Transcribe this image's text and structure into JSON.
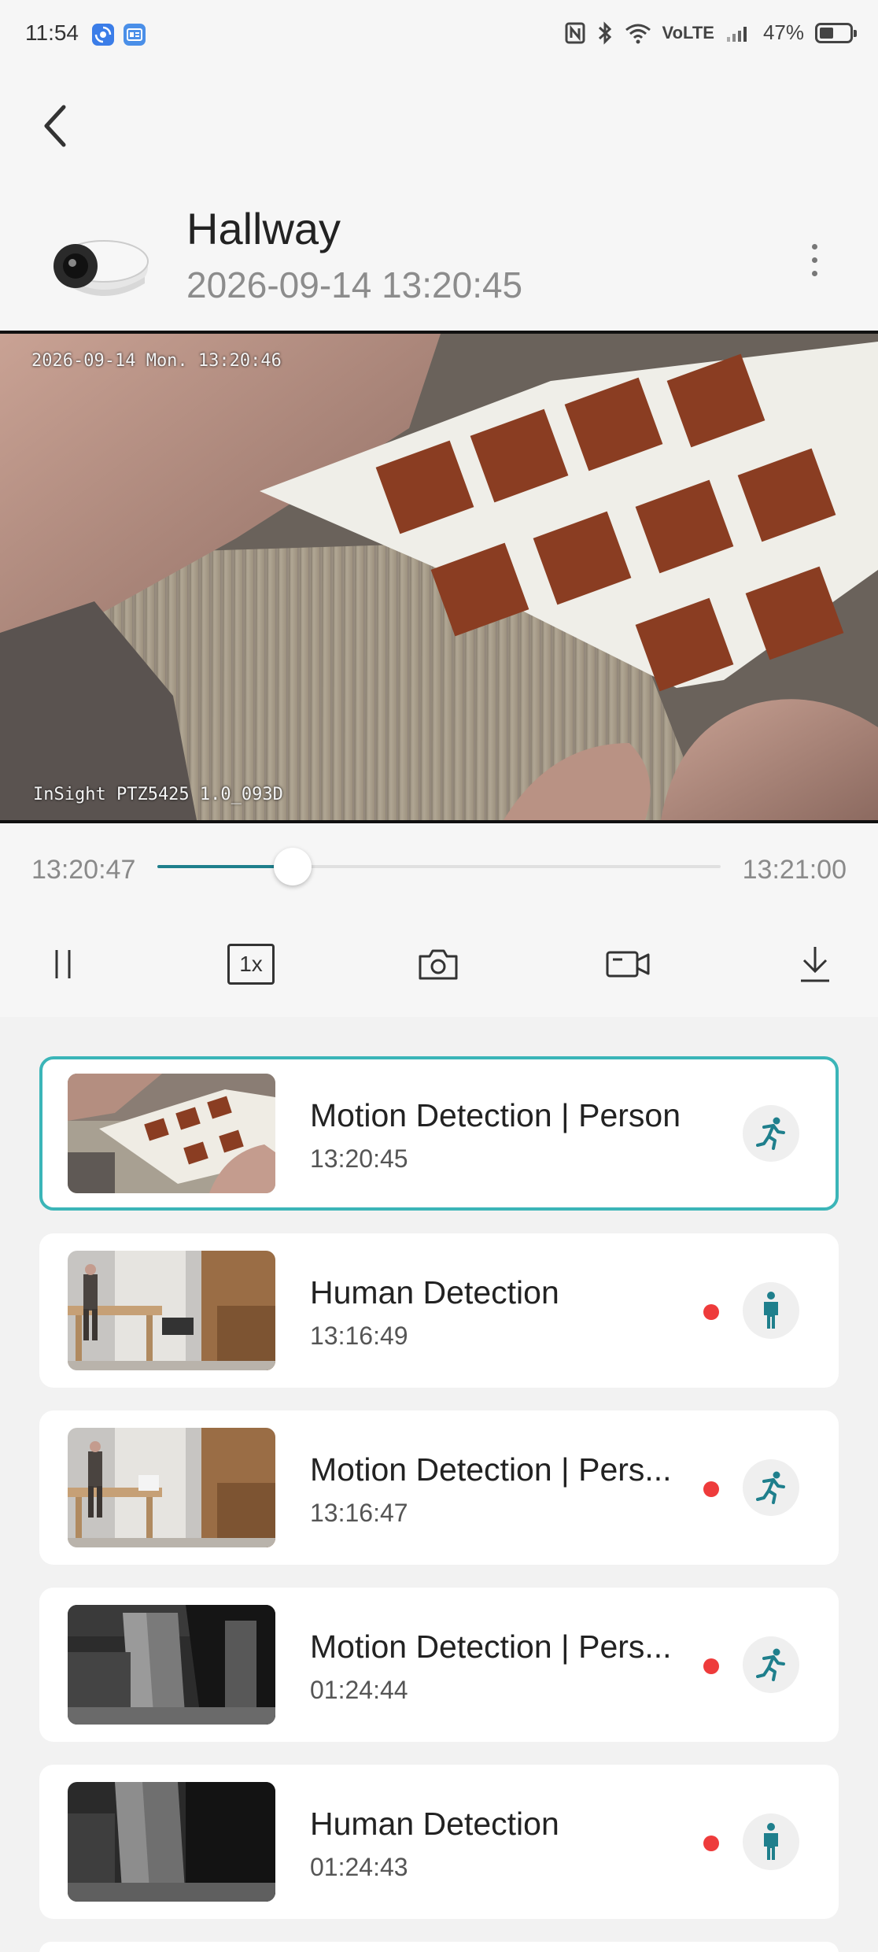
{
  "status_bar": {
    "time": "11:54",
    "volte": "VoLTE",
    "battery": "47%",
    "battery_level": 0.47,
    "icons": [
      "nfc-icon",
      "bluetooth-icon",
      "wifi-icon",
      "signal-icon",
      "battery-icon"
    ]
  },
  "header": {
    "camera_name": "Hallway",
    "timestamp": "2026-09-14 13:20:45"
  },
  "video": {
    "osd_time": "2026-09-14 Mon. 13:20:46",
    "osd_model": "InSight PTZ5425 1.0_093D"
  },
  "scrubber": {
    "start": "13:20:47",
    "end": "13:21:00",
    "progress": 0.24
  },
  "controls": {
    "speed": "1x",
    "items": [
      "pause-icon",
      "speed-button",
      "snapshot-icon",
      "record-icon",
      "download-icon"
    ]
  },
  "events": [
    {
      "title": "Motion Detection | Person",
      "time": "13:20:45",
      "type": "running-person-icon",
      "unread": false,
      "active": true
    },
    {
      "title": "Human Detection",
      "time": "13:16:49",
      "type": "standing-person-icon",
      "unread": true,
      "active": false
    },
    {
      "title": "Motion Detection | Pers...",
      "time": "13:16:47",
      "type": "running-person-icon",
      "unread": true,
      "active": false
    },
    {
      "title": "Motion Detection | Pers...",
      "time": "01:24:44",
      "type": "running-person-icon",
      "unread": true,
      "active": false
    },
    {
      "title": "Human Detection",
      "time": "01:24:43",
      "type": "standing-person-icon",
      "unread": true,
      "active": false
    }
  ],
  "colors": {
    "accent": "#1f7f8c",
    "active_border": "#3bb5b8",
    "unread_dot": "#ee3b3b",
    "background": "#f2f2f2"
  }
}
